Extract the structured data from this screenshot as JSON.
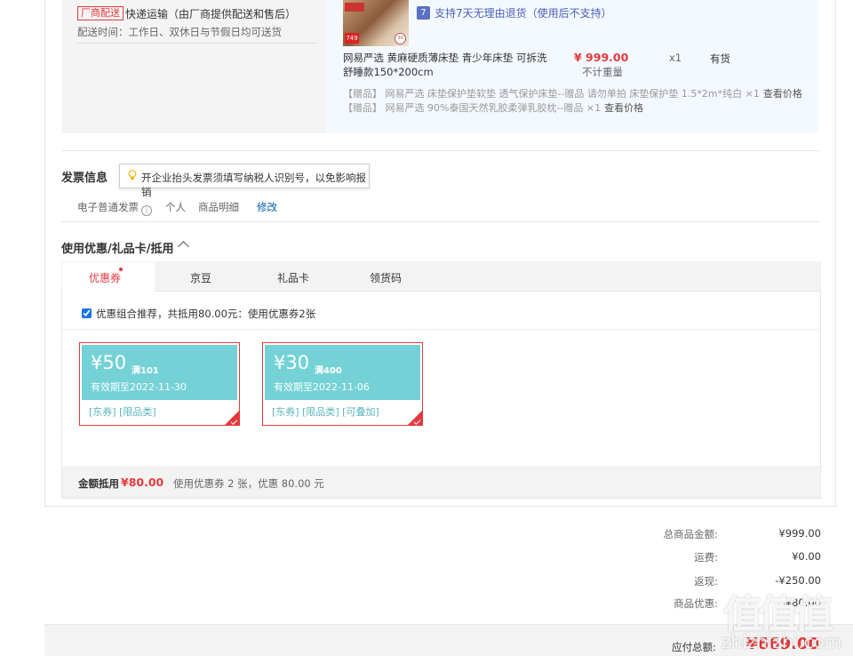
{
  "delivery": {
    "vendor_tag": "厂商配送",
    "method": "快递运输（由厂商提供配送和售后）",
    "time": "配送时间：工作日、双休日与节假日均可送货"
  },
  "product": {
    "thumb_price": "749",
    "thumb_badge": "3d",
    "return_badge": "7",
    "return_policy": "支持7天无理由退货（使用后不支持）",
    "name_line1": "网易严选 黄麻硬质薄床垫 青少年床垫 可拆洗",
    "name_line2": "舒睡款150*200cm",
    "price": "¥ 999.00",
    "weight": "不计重量",
    "qty": "x1",
    "stock": "有货",
    "gifts": [
      {
        "text": "【赠品】  网易严选 床垫保护垫软垫 透气保护床垫--赠品 请勿单拍 床垫保护垫 1.5*2m*纯白 ×1",
        "link": "查看价格"
      },
      {
        "text": "【赠品】  网易严选 90%泰国天然乳胶柔弹乳胶枕--赠品 ×1",
        "link": "查看价格"
      }
    ]
  },
  "invoice": {
    "title": "发票信息",
    "tip": "开企业抬头发票须填写纳税人识别号，以免影响报销",
    "type": "电子普通发票",
    "info_icon": "i",
    "who": "个人",
    "content": "商品明细",
    "edit": "修改"
  },
  "coupons": {
    "title": "使用优惠/礼品卡/抵用",
    "tabs": [
      "优惠券",
      "京豆",
      "礼品卡",
      "领货码"
    ],
    "combo": "优惠组合推荐，共抵用80.00元：使用优惠券2张",
    "items": [
      {
        "amount": "¥50",
        "cond": "满101",
        "valid": "有效期至2022-11-30",
        "tags": "[东券]  [限品类]"
      },
      {
        "amount": "¥30",
        "cond": "满400",
        "valid": "有效期至2022-11-06",
        "tags": "[东券]  [限品类]  [可叠加]"
      }
    ],
    "footer_label": "金额抵用",
    "footer_value": "¥80.00",
    "footer_desc": "使用优惠券 2 张，优惠 80.00 元"
  },
  "summary": {
    "rows": [
      {
        "label": "总商品金额:",
        "value": "¥999.00"
      },
      {
        "label": "运费:",
        "value": "¥0.00"
      },
      {
        "label": "返现:",
        "value": "-¥250.00"
      },
      {
        "label": "商品优惠:",
        "value": "-¥80.00"
      }
    ],
    "total_label": "应付总额:",
    "total_value": "¥669.00"
  },
  "watermark": {
    "logo": "值值值",
    "url": "zhizhizhi.com"
  }
}
